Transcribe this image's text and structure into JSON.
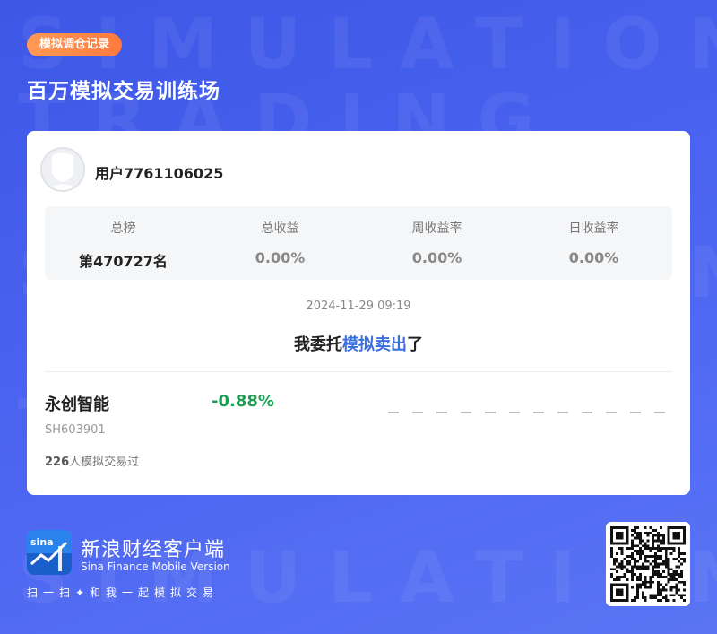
{
  "header": {
    "tag": "模拟调仓记录",
    "title": "百万模拟交易训练场"
  },
  "watermark": {
    "lines": [
      "SIMULATION",
      "TRADING",
      "SIMULATION",
      "TRADING",
      "SIMULATION"
    ]
  },
  "user": {
    "name": "用户7761106025"
  },
  "stats": [
    {
      "label": "总榜",
      "value": "第470727名"
    },
    {
      "label": "总收益",
      "value": "0.00%"
    },
    {
      "label": "周收益率",
      "value": "0.00%"
    },
    {
      "label": "日收益率",
      "value": "0.00%"
    }
  ],
  "record": {
    "datetime": "2024-11-29 09:19",
    "action_prefix": "我委托",
    "action_highlight": "模拟卖出",
    "action_suffix": "了"
  },
  "stock": {
    "name": "永创智能",
    "code": "SH603901",
    "change": "-0.88%",
    "traded_count": "226",
    "traded_suffix": "人模拟交易过"
  },
  "footer": {
    "brand_cn": "新浪财经客户端",
    "brand_en": "Sina Finance Mobile Version",
    "slogan": "扫一扫✦和我一起模拟交易",
    "logo_text": "sina"
  },
  "colors": {
    "background": "#4a63f0",
    "accent": "#3a6fe0",
    "tag": "#ff7a3d",
    "negative": "#1aa053"
  },
  "icons": {
    "avatar": "user-avatar-icon",
    "logo": "sina-finance-logo-icon",
    "qr": "qr-code-icon"
  }
}
